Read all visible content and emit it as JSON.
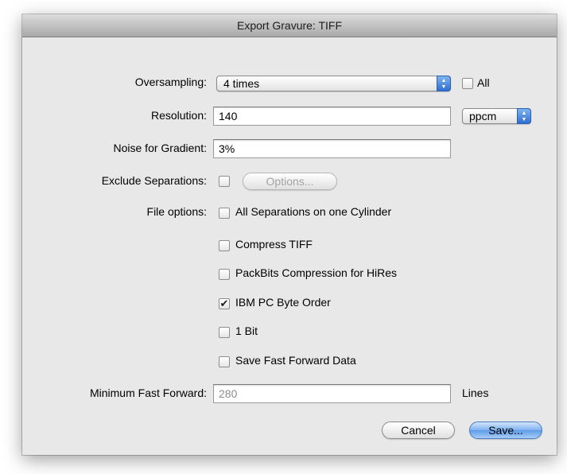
{
  "dialog": {
    "title": "Export Gravure: TIFF"
  },
  "oversampling": {
    "label": "Oversampling:",
    "value": "4 times",
    "all_label": "All",
    "all_checked": false
  },
  "resolution": {
    "label": "Resolution:",
    "value": "140",
    "unit": "ppcm"
  },
  "noise": {
    "label": "Noise for Gradient:",
    "value": "3%"
  },
  "exclude": {
    "label": "Exclude Separations:",
    "checked": false,
    "options_button": "Options..."
  },
  "file_options": {
    "label": "File options:",
    "items": [
      {
        "label": "All Separations on one Cylinder",
        "checked": false
      },
      {
        "label": "Compress TIFF",
        "checked": false
      },
      {
        "label": "PackBits Compression for HiRes",
        "checked": false
      },
      {
        "label": "IBM PC Byte Order",
        "checked": true
      },
      {
        "label": "1 Bit",
        "checked": false
      },
      {
        "label": "Save Fast Forward Data",
        "checked": false
      }
    ]
  },
  "min_fast_forward": {
    "label": "Minimum Fast Forward:",
    "value": "280",
    "unit": "Lines"
  },
  "buttons": {
    "cancel": "Cancel",
    "save": "Save..."
  },
  "glyphs": {
    "check": "✔",
    "up_arrow": "▲",
    "down_arrow": "▼"
  }
}
